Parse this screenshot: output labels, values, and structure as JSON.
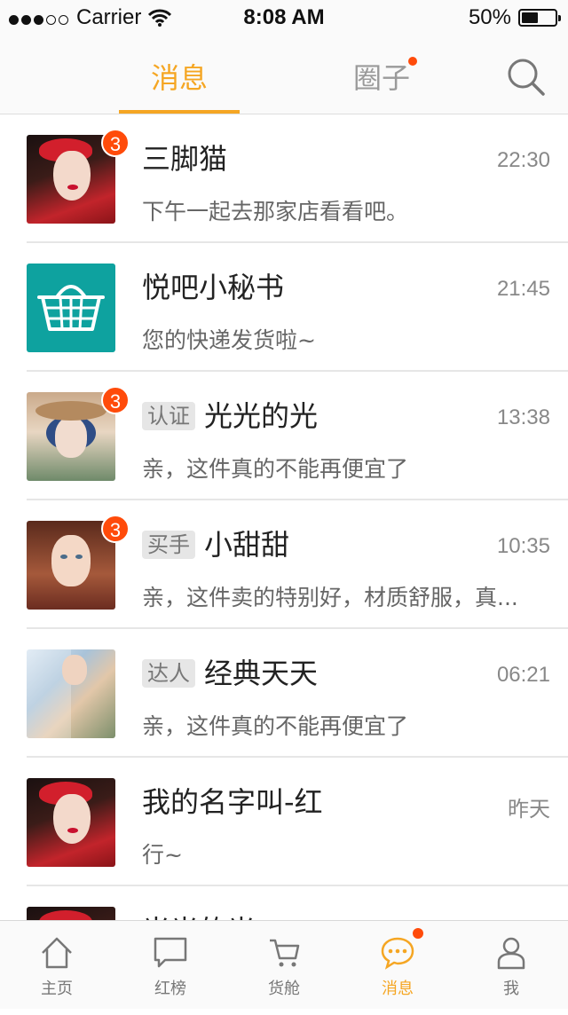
{
  "status_bar": {
    "carrier": "Carrier",
    "time": "8:08 AM",
    "battery": "50%"
  },
  "top_tabs": {
    "messages": "消息",
    "circle": "圈子"
  },
  "chats": [
    {
      "name": "三脚猫",
      "tag": "",
      "time": "22:30",
      "preview": "下午一起去那家店看看吧。",
      "badge": "3",
      "avatar": "red-hat-woman"
    },
    {
      "name": "悦吧小秘书",
      "tag": "",
      "time": "21:45",
      "preview": "您的快递发货啦~",
      "badge": "",
      "avatar": "shopping-basket"
    },
    {
      "name": "光光的光",
      "tag": "认证",
      "time": "13:38",
      "preview": "亲，这件真的不能再便宜了",
      "badge": "3",
      "avatar": "hat-woman"
    },
    {
      "name": "小甜甜",
      "tag": "买手",
      "time": "10:35",
      "preview": "亲，这件卖的特别好，材质舒服，真...",
      "badge": "3",
      "avatar": "girl"
    },
    {
      "name": "经典天天",
      "tag": "达人",
      "time": "06:21",
      "preview": "亲，这件真的不能再便宜了",
      "badge": "",
      "avatar": "fold-photo"
    },
    {
      "name": "我的名字叫-红",
      "tag": "",
      "time": "昨天",
      "preview": "行~",
      "badge": "",
      "avatar": "red-hat-woman"
    },
    {
      "name": "光光的光",
      "tag": "",
      "time": "",
      "preview": "",
      "badge": "",
      "avatar": "red-hat-woman"
    }
  ],
  "tab_bar": {
    "home": "主页",
    "ranking": "红榜",
    "cart": "货舱",
    "messages": "消息",
    "me": "我"
  },
  "colors": {
    "accent": "#f5a623",
    "badge": "#ff4b0a",
    "teal": "#0ea29f"
  }
}
